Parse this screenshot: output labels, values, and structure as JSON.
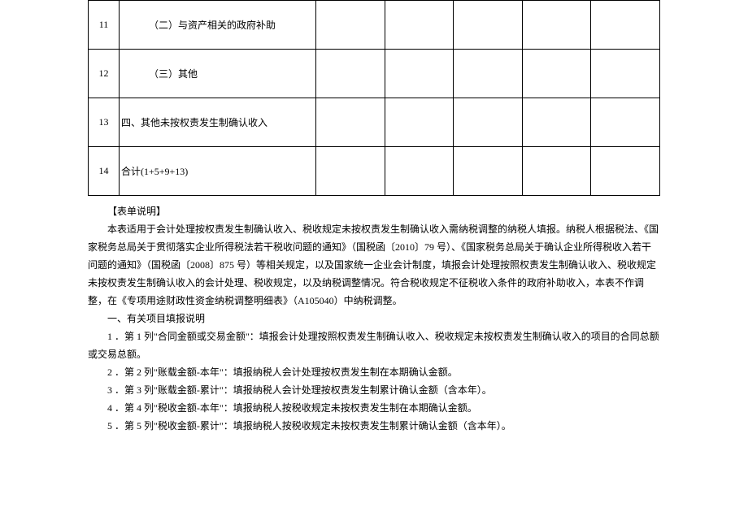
{
  "table": {
    "rows": [
      {
        "num": "11",
        "desc": "（二）与资产相关的政府补助",
        "indent": true
      },
      {
        "num": "12",
        "desc": "（三）其他",
        "indent": true
      },
      {
        "num": "13",
        "desc": "四、其他未按权责发生制确认收入",
        "indent": false
      },
      {
        "num": "14",
        "desc": "合计(1+5+9+13)",
        "indent": false
      }
    ]
  },
  "explain": {
    "title": "【表单说明】",
    "para1": "本表适用于会计处理按权责发生制确认收入、税收规定未按权责发生制确认收入需纳税调整的纳税人填报。纳税人根据税法、《国家税务总局关于贯彻落实企业所得税法若干税收问题的通知》（国税函〔2010〕79 号）、《国家税务总局关于确认企业所得税收入若干问题的通知》（国税函〔2008〕875 号）等相关规定，以及国家统一企业会计制度，填报会计处理按照权责发生制确认收入、税收规定未按权责发生制确认收入的会计处理、税收规定，以及纳税调整情况。符合税收规定不征税收入条件的政府补助收入，本表不作调整，在《专项用途财政性资金纳税调整明细表》（A105040）中纳税调整。",
    "section1": "一、有关项目填报说明",
    "item1": "1 ．第 1 列\"合同金额或交易金额\"：填报会计处理按照权责发生制确认收入、税收规定未按权责发生制确认收入的项目的合同总额或交易总额。",
    "item2": "2 ．第 2 列\"账载金额-本年\"：填报纳税人会计处理按权责发生制在本期确认金额。",
    "item3": "3 ．第 3 列\"账载金额-累计\"：填报纳税人会计处理按权责发生制累计确认金额（含本年）。",
    "item4": "4 ．第 4 列\"税收金额-本年\"：填报纳税人按税收规定未按权责发生制在本期确认金额。",
    "item5": "5 ．第 5 列\"税收金额-累计\"：填报纳税人按税收规定未按权责发生制累计确认金额（含本年）。"
  }
}
